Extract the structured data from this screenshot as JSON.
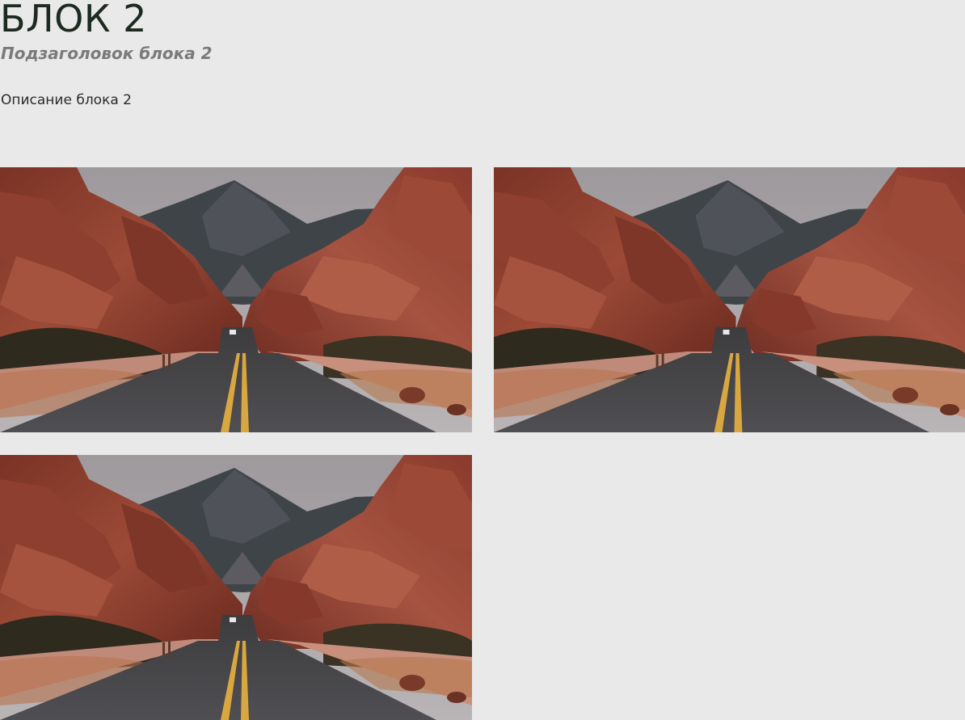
{
  "block": {
    "title": "БЛОК 2",
    "subtitle": "Подзаголовок блока 2",
    "description": "Описание блока 2"
  },
  "gallery": {
    "items": [
      {
        "image": "desert-road-red-rocks-photo"
      },
      {
        "image": "desert-road-red-rocks-photo"
      },
      {
        "image": "desert-road-red-rocks-photo"
      }
    ]
  }
}
